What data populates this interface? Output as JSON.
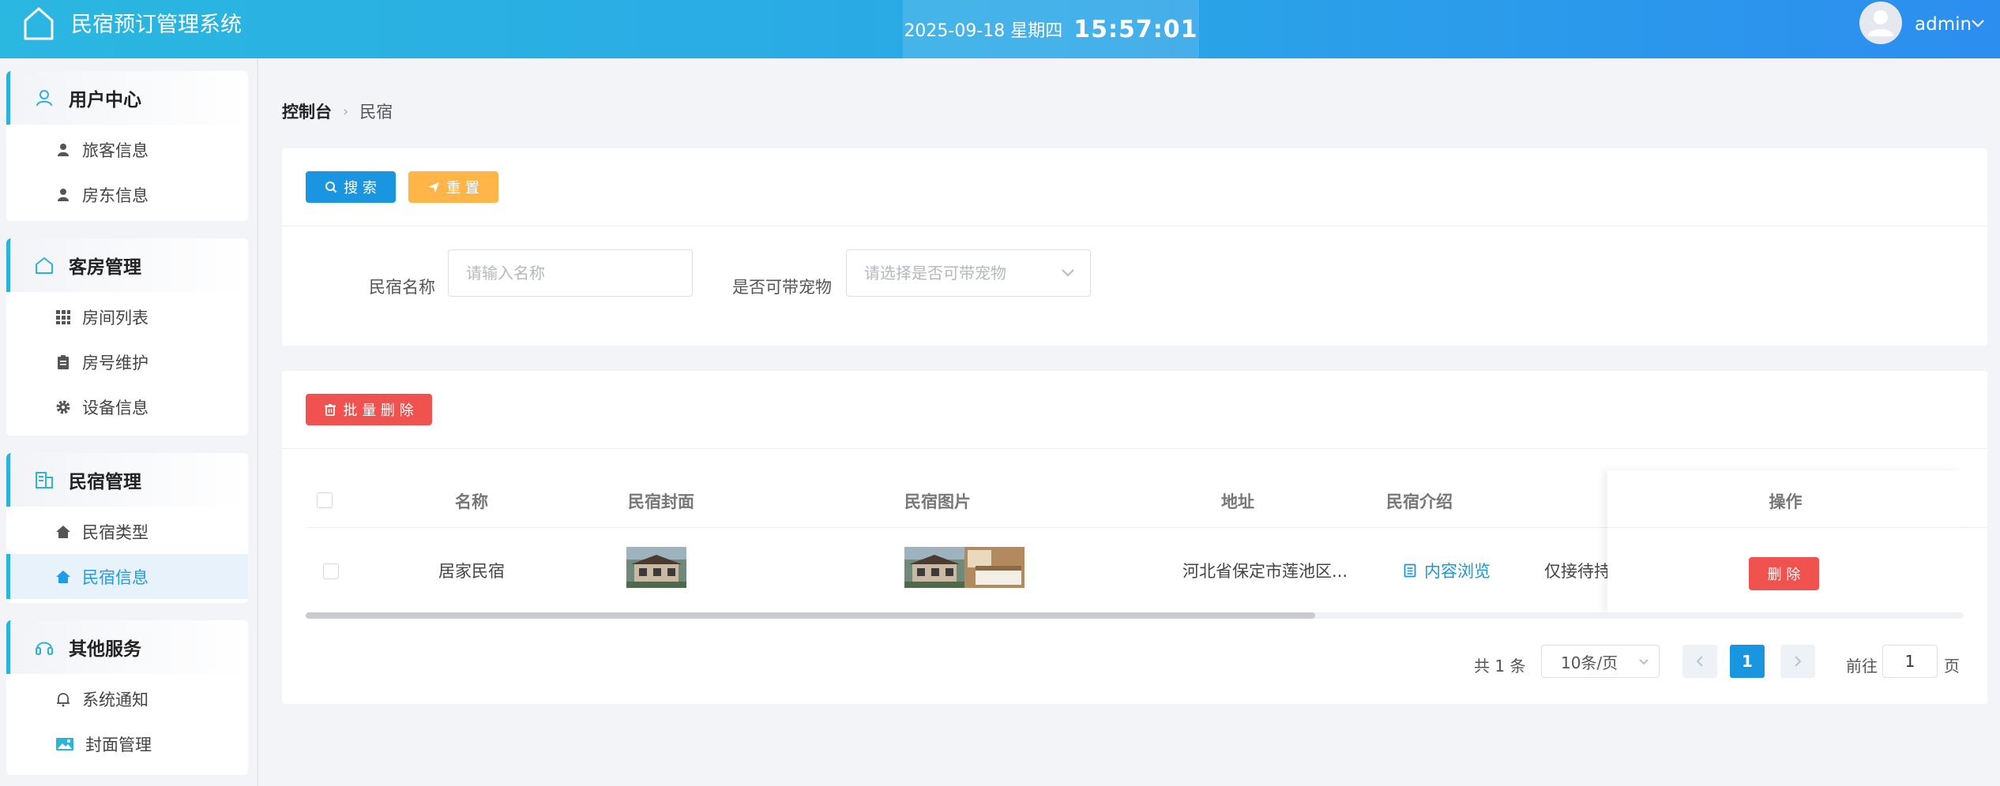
{
  "header": {
    "app_title": "民宿预订管理系统",
    "date": "2025-09-18 星期四",
    "time": "15:57:01",
    "user": "admin"
  },
  "sidebar": {
    "groups": [
      {
        "title": "用户中心",
        "icon": "user-outline-icon",
        "items": [
          {
            "label": "旅客信息",
            "icon": "person-icon"
          },
          {
            "label": "房东信息",
            "icon": "person-icon"
          }
        ]
      },
      {
        "title": "客房管理",
        "icon": "home-outline-icon",
        "items": [
          {
            "label": "房间列表",
            "icon": "grid-icon"
          },
          {
            "label": "房号维护",
            "icon": "clipboard-icon"
          },
          {
            "label": "设备信息",
            "icon": "gear-icon"
          }
        ]
      },
      {
        "title": "民宿管理",
        "icon": "building-icon",
        "items": [
          {
            "label": "民宿类型",
            "icon": "house-icon"
          },
          {
            "label": "民宿信息",
            "icon": "house-icon",
            "active": true
          }
        ]
      },
      {
        "title": "其他服务",
        "icon": "headset-icon",
        "items": [
          {
            "label": "系统通知",
            "icon": "bell-icon"
          },
          {
            "label": "封面管理",
            "icon": "image-icon"
          }
        ]
      }
    ]
  },
  "breadcrumb": {
    "root": "控制台",
    "current": "民宿"
  },
  "search_panel": {
    "search_label": "搜 索",
    "reset_label": "重 置",
    "name_label": "民宿名称",
    "name_placeholder": "请输入名称",
    "pet_label": "是否可带宠物",
    "pet_placeholder": "请选择是否可带宠物"
  },
  "table_panel": {
    "batch_delete_label": "批 量 删 除",
    "columns": [
      "名称",
      "民宿封面",
      "民宿图片",
      "地址",
      "民宿介绍",
      "操作"
    ],
    "rows": [
      {
        "name": "居家民宿",
        "address": "河北省保定市莲池区...",
        "intro_link": "内容浏览",
        "extra": "仅接待持",
        "delete_label": "删 除"
      }
    ]
  },
  "pagination": {
    "total": "共 1 条",
    "page_size": "10条/页",
    "current": "1",
    "goto_label": "前往",
    "goto_value": "1",
    "page_suffix": "页"
  },
  "colors": {
    "primary": "#1a96e0",
    "warning": "#ffb547",
    "danger": "#f0524f",
    "accent": "#2bb4d8"
  }
}
